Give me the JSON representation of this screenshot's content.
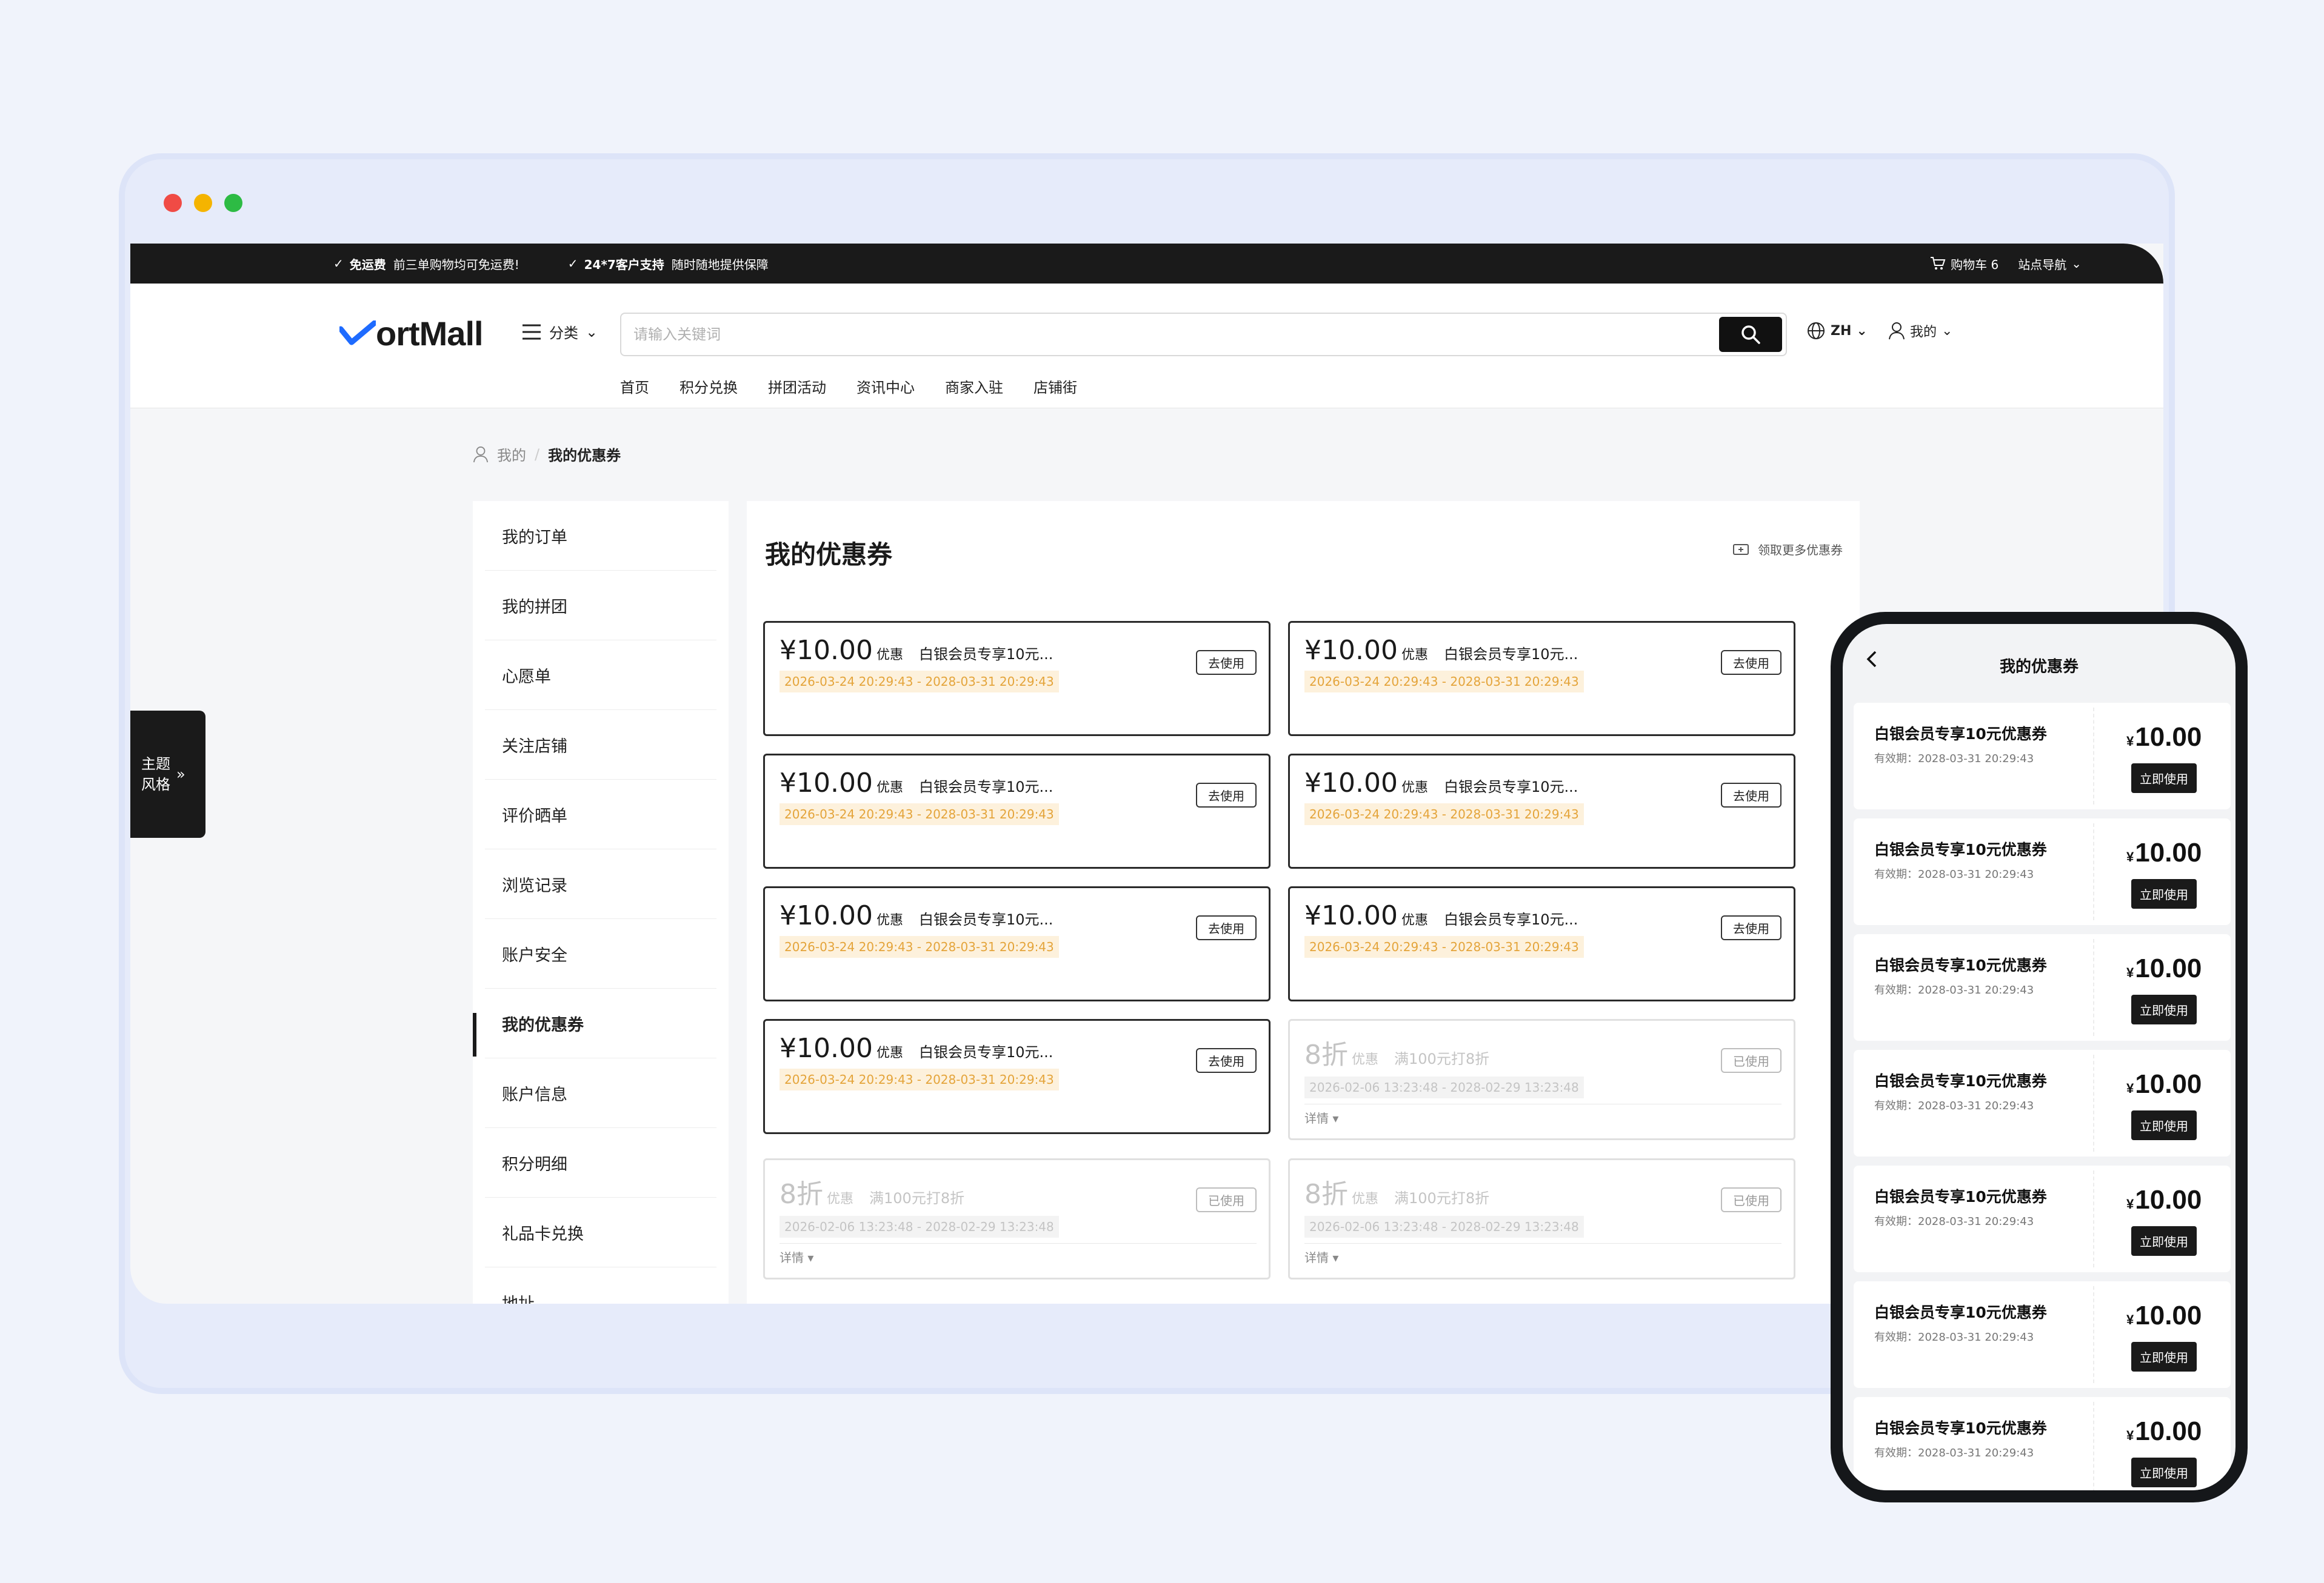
{
  "window": {
    "dot_colors": [
      "#f04b45",
      "#f5b400",
      "#2dbb44"
    ]
  },
  "topbar": {
    "promos": [
      {
        "bold": "免运费",
        "text": "前三单购物均可免运费!"
      },
      {
        "bold": "24*7客户支持",
        "text": "随时随地提供保障"
      }
    ],
    "cart": "购物车 6",
    "site_nav": "站点导航"
  },
  "header": {
    "logo": "ortMall",
    "category": "分类",
    "search_placeholder": "请输入关键词",
    "lang": "ZH",
    "mine": "我的",
    "nav": [
      "首页",
      "积分兑换",
      "拼团活动",
      "资讯中心",
      "商家入驻",
      "店铺街"
    ]
  },
  "breadcrumb": {
    "parent": "我的",
    "separator": "/",
    "current": "我的优惠券"
  },
  "sidebar": {
    "items": [
      "我的订单",
      "我的拼团",
      "心愿单",
      "关注店铺",
      "评价晒单",
      "浏览记录",
      "账户安全",
      "我的优惠券",
      "账户信息",
      "积分明细",
      "礼品卡兑换",
      "地址"
    ],
    "active_index": 7
  },
  "theme_switch": {
    "line1": "主题",
    "line2": "风格"
  },
  "main": {
    "title": "我的优惠券",
    "more": "领取更多优惠券",
    "coupons": [
      {
        "amount": "¥10.00",
        "unit": "优惠",
        "desc": "白银会员专享10元...",
        "date": "2026-03-24 20:29:43 - 2028-03-31 20:29:43",
        "button": "去使用"
      },
      {
        "amount": "¥10.00",
        "unit": "优惠",
        "desc": "白银会员专享10元...",
        "date": "2026-03-24 20:29:43 - 2028-03-31 20:29:43",
        "button": "去使用"
      },
      {
        "amount": "¥10.00",
        "unit": "优惠",
        "desc": "白银会员专享10元...",
        "date": "2026-03-24 20:29:43 - 2028-03-31 20:29:43",
        "button": "去使用"
      },
      {
        "amount": "¥10.00",
        "unit": "优惠",
        "desc": "白银会员专享10元...",
        "date": "2026-03-24 20:29:43 - 2028-03-31 20:29:43",
        "button": "去使用"
      },
      {
        "amount": "¥10.00",
        "unit": "优惠",
        "desc": "白银会员专享10元...",
        "date": "2026-03-24 20:29:43 - 2028-03-31 20:29:43",
        "button": "去使用"
      },
      {
        "amount": "¥10.00",
        "unit": "优惠",
        "desc": "白银会员专享10元...",
        "date": "2026-03-24 20:29:43 - 2028-03-31 20:29:43",
        "button": "去使用"
      },
      {
        "amount": "¥10.00",
        "unit": "优惠",
        "desc": "白银会员专享10元...",
        "date": "2026-03-24 20:29:43 - 2028-03-31 20:29:43",
        "button": "去使用"
      }
    ],
    "used_coupons": [
      {
        "amount": "8折",
        "unit": "优惠",
        "desc": "满100元打8折",
        "date": "2026-02-06 13:23:48 - 2028-02-29 13:23:48",
        "button": "已使用",
        "detail": "详情 ▾"
      },
      {
        "amount": "8折",
        "unit": "优惠",
        "desc": "满100元打8折",
        "date": "2026-02-06 13:23:48 - 2028-02-29 13:23:48",
        "button": "已使用",
        "detail": "详情 ▾"
      },
      {
        "amount": "8折",
        "unit": "优惠",
        "desc": "满100元打8折",
        "date": "2026-02-06 13:23:48 - 2028-02-29 13:23:48",
        "button": "已使用",
        "detail": "详情 ▾"
      }
    ]
  },
  "phone": {
    "title": "我的优惠券",
    "cards": [
      {
        "name": "白银会员专享10元优惠券",
        "valid": "有效期：2028-03-31 20:29:43",
        "currency": "¥",
        "price": "10.00",
        "button": "立即使用"
      },
      {
        "name": "白银会员专享10元优惠券",
        "valid": "有效期：2028-03-31 20:29:43",
        "currency": "¥",
        "price": "10.00",
        "button": "立即使用"
      },
      {
        "name": "白银会员专享10元优惠券",
        "valid": "有效期：2028-03-31 20:29:43",
        "currency": "¥",
        "price": "10.00",
        "button": "立即使用"
      },
      {
        "name": "白银会员专享10元优惠券",
        "valid": "有效期：2028-03-31 20:29:43",
        "currency": "¥",
        "price": "10.00",
        "button": "立即使用"
      },
      {
        "name": "白银会员专享10元优惠券",
        "valid": "有效期：2028-03-31 20:29:43",
        "currency": "¥",
        "price": "10.00",
        "button": "立即使用"
      },
      {
        "name": "白银会员专享10元优惠券",
        "valid": "有效期：2028-03-31 20:29:43",
        "currency": "¥",
        "price": "10.00",
        "button": "立即使用"
      },
      {
        "name": "白银会员专享10元优惠券",
        "valid": "有效期：2028-03-31 20:29:43",
        "currency": "¥",
        "price": "10.00",
        "button": "立即使用"
      }
    ]
  }
}
